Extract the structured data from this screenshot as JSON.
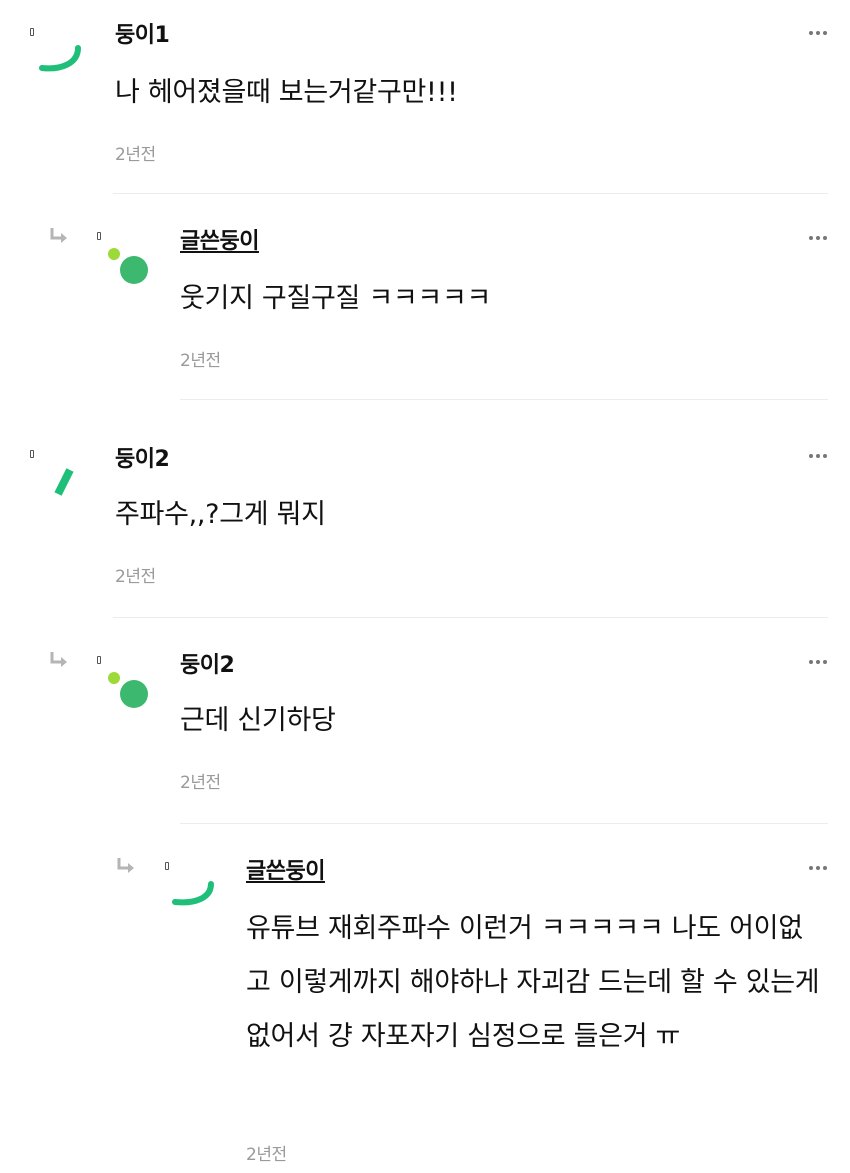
{
  "comments": [
    {
      "author": "둥이1",
      "text": "나 헤어졌을때 보는거같구만!!!",
      "time": "2년전"
    },
    {
      "author": "글쓴둥이",
      "text": "웃기지 구질구질 ㅋㅋㅋㅋㅋ",
      "time": "2년전"
    },
    {
      "author": "둥이2",
      "text": "주파수,,?그게 뭐지",
      "time": "2년전"
    },
    {
      "author": "둥이2",
      "text": "근데 신기하당",
      "time": "2년전"
    },
    {
      "author": "글쓴둥이",
      "text": "유튜브 재회주파수 이런거 ㅋㅋㅋㅋㅋ 나도 어이없고 이렇게까지 해야하나 자괴감 드는데 할 수 있는게 없어서 걍 자포자기 심정으로 들은거 ㅠ",
      "time": "2년전"
    }
  ],
  "icons": {
    "reply": "reply-arrow-icon",
    "more": "more-options-icon"
  },
  "colors": {
    "avatar_green": "#1fbf7a",
    "avatar_lime": "#9ed93a",
    "avatar_dot": "#3cb96f",
    "time": "#9a9a9a",
    "divider": "#ececec"
  }
}
